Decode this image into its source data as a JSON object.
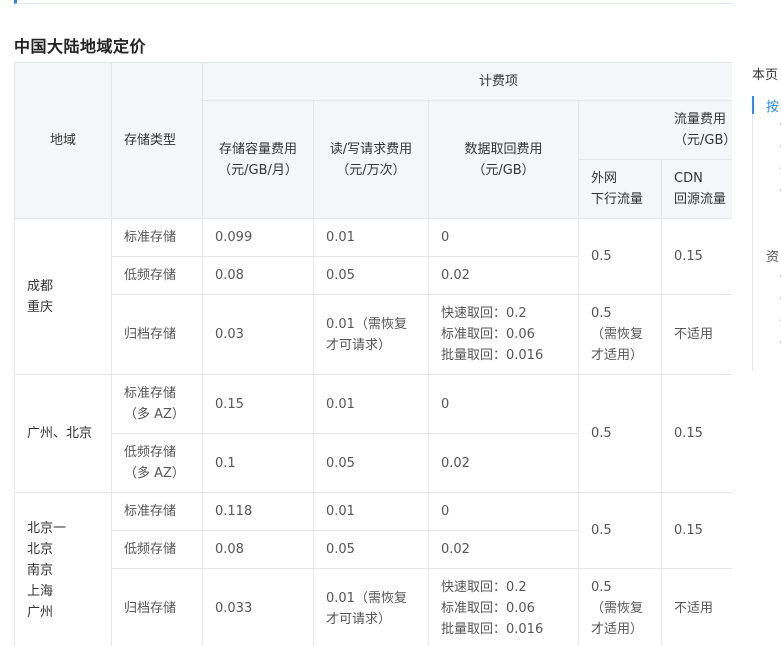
{
  "section_title": "中国大陆地域定价",
  "table": {
    "header": {
      "region": "地域",
      "storage_type": "存储类型",
      "billing_items": "计费项",
      "capacity_fee": "存储容量费用\n（元/GB/月）",
      "request_fee": "读/写请求费用\n（元/万次）",
      "retrieval_fee": "数据取回费用\n（元/GB）",
      "traffic_fee": "流量费用\n（元/GB）",
      "internet_out": "外网\n下行流量",
      "cdn_origin": "CDN\n回源流量"
    },
    "group1": {
      "region": "成都\n重庆",
      "rows": [
        {
          "type": "标准存储",
          "capacity": "0.099",
          "request": "0.01",
          "retrieval": "0"
        },
        {
          "type": "低频存储",
          "capacity": "0.08",
          "request": "0.05",
          "retrieval": "0.02"
        },
        {
          "type": "归档存储",
          "capacity": "0.03",
          "request": "0.01（需恢复\n才可请求）",
          "retrieval": "快速取回：0.2\n标准取回：0.06\n批量取回：0.016"
        }
      ],
      "internet_a": "0.5",
      "cdn_a": "0.15",
      "internet_b": "0.5\n（需恢复\n才适用）",
      "cdn_b": "不适用"
    },
    "group2": {
      "region": "广州、北京",
      "rows": [
        {
          "type": "标准存储\n（多 AZ）",
          "capacity": "0.15",
          "request": "0.01",
          "retrieval": "0"
        },
        {
          "type": "低频存储\n（多 AZ）",
          "capacity": "0.1",
          "request": "0.05",
          "retrieval": "0.02"
        }
      ],
      "internet": "0.5",
      "cdn": "0.15"
    },
    "group3": {
      "region": "北京一\n北京\n南京\n上海\n广州",
      "rows": [
        {
          "type": "标准存储",
          "capacity": "0.118",
          "request": "0.01",
          "retrieval": "0"
        },
        {
          "type": "低频存储",
          "capacity": "0.08",
          "request": "0.05",
          "retrieval": "0.02"
        },
        {
          "type": "归档存储",
          "capacity": "0.033",
          "request": "0.01（需恢复\n才可请求）",
          "retrieval": "快速取回：0.2\n标准取回：0.06\n批量取回：0.016"
        }
      ],
      "internet_a": "0.5",
      "cdn_a": "0.15",
      "internet_b": "0.5\n（需恢复\n才适用）",
      "cdn_b": "不适用"
    }
  },
  "toc": {
    "title": "本页",
    "item_active": "按",
    "item_second": "资"
  },
  "colors": {
    "accent": "#2a8bf0",
    "header_bg": "#f4f6f9",
    "border": "#e3e6eb"
  }
}
